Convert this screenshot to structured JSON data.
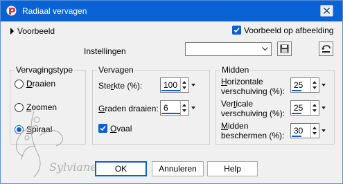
{
  "window": {
    "title": "Radiaal vervagen",
    "close_icon": "close-icon",
    "accent": "#0a63d4"
  },
  "preview": {
    "label": "Voorbeeld",
    "on_image_label": "Voorbeeld op afbeelding",
    "on_image_checked": true
  },
  "settings": {
    "label": "Instellingen",
    "value": "",
    "save_icon": "floppy-disk-icon",
    "reset_icon": "reset-icon"
  },
  "blur_type": {
    "title": "Vervagingstype",
    "options": [
      {
        "label": "Draaien",
        "access": "D",
        "rest": "raaien",
        "selected": false
      },
      {
        "label": "Zoomen",
        "access": "Z",
        "rest": "oomen",
        "selected": false
      },
      {
        "label": "Spiraal",
        "access": "S",
        "rest": "piraal",
        "selected": true
      }
    ]
  },
  "blur": {
    "title": "Vervagen",
    "strength": {
      "pre": "Ste",
      "access": "r",
      "post": "kte (%):",
      "value": "100"
    },
    "rotate": {
      "access": "G",
      "post": "raden draaien:",
      "value": "6"
    },
    "oval": {
      "access": "O",
      "post": "vaal",
      "checked": true
    }
  },
  "center": {
    "title": "Midden",
    "h_offset": {
      "access": "H",
      "post": "orizontale",
      "line2": "verschuiving (%):",
      "value": "25"
    },
    "v_offset": {
      "pre": "Ver",
      "access": "t",
      "post": "icale",
      "line2": "verschuiving (%):",
      "value": "25"
    },
    "protect": {
      "access": "M",
      "post": "idden",
      "line2": "beschermen (%):",
      "value": "30"
    }
  },
  "buttons": {
    "ok": "OK",
    "cancel": "Annuleren",
    "help": "Help"
  },
  "watermark": {
    "text": "Sylviane"
  }
}
